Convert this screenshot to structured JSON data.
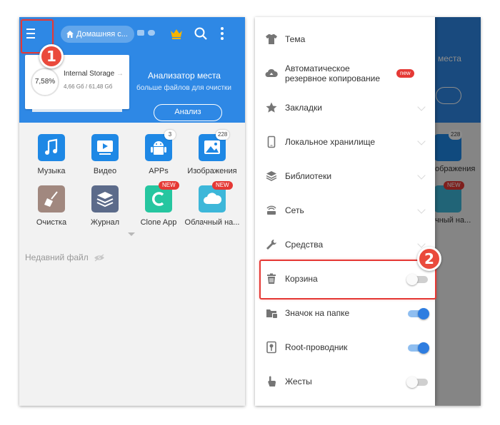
{
  "left": {
    "home_chip": "Домашняя с...",
    "storage": {
      "percent": "7,58%",
      "name": "Internal Storage",
      "arrow": "→",
      "size": "4,66 Gб / 61,48 Gб"
    },
    "analyzer": {
      "title": "Анализатор места",
      "subtitle": "больше файлов для очистки",
      "button": "Анализ"
    },
    "tiles": [
      {
        "label": "Музыка",
        "icon": "music-icon",
        "color": "#1e88e5"
      },
      {
        "label": "Видео",
        "icon": "video-icon",
        "color": "#1e88e5"
      },
      {
        "label": "APPs",
        "icon": "android-icon",
        "color": "#1e88e5",
        "badge": "3"
      },
      {
        "label": "Изображения",
        "icon": "image-icon",
        "color": "#1e88e5",
        "badge": "228"
      },
      {
        "label": "Очистка",
        "icon": "broom-icon",
        "color": "#a1887f"
      },
      {
        "label": "Журнал",
        "icon": "stack-icon",
        "color": "#5c6b8a"
      },
      {
        "label": "Clone App",
        "icon": "clone-icon",
        "color": "#26c6a0",
        "new": "NEW"
      },
      {
        "label": "Облачный на...",
        "icon": "cloud-icon",
        "color": "#3db7d9",
        "new": "NEW"
      }
    ],
    "recent": "Недавний файл"
  },
  "menu": [
    {
      "label": "Тема",
      "icon": "shirt-icon"
    },
    {
      "label": "Автоматическое резервное копирование",
      "line1": "Автоматическое",
      "line2": "резервное копирование",
      "icon": "cloud-backup-icon",
      "tag": "new"
    },
    {
      "label": "Закладки",
      "icon": "star-icon",
      "expandable": true
    },
    {
      "label": "Локальное хранилище",
      "icon": "phone-icon",
      "expandable": true
    },
    {
      "label": "Библиотеки",
      "icon": "layers-icon",
      "expandable": true
    },
    {
      "label": "Сеть",
      "icon": "network-icon",
      "expandable": true
    },
    {
      "label": "Средства",
      "icon": "wrench-icon",
      "expandable": true
    },
    {
      "label": "Корзина",
      "icon": "trash-icon",
      "toggle": "off"
    },
    {
      "label": "Значок на папке",
      "icon": "folder-badge-icon",
      "toggle": "on"
    },
    {
      "label": "Root-проводник",
      "icon": "root-icon",
      "toggle": "on"
    },
    {
      "label": "Жесты",
      "icon": "gesture-icon",
      "toggle": "off"
    }
  ],
  "behind": {
    "title_partial": "места",
    "badge": "228",
    "new": "NEW",
    "label1": "ображения",
    "label2": "чный на..."
  },
  "steps": [
    "1",
    "2"
  ],
  "colors": {
    "accent": "#2e88e5",
    "callout": "#e53935",
    "toggle_on": "#2e7de0"
  }
}
